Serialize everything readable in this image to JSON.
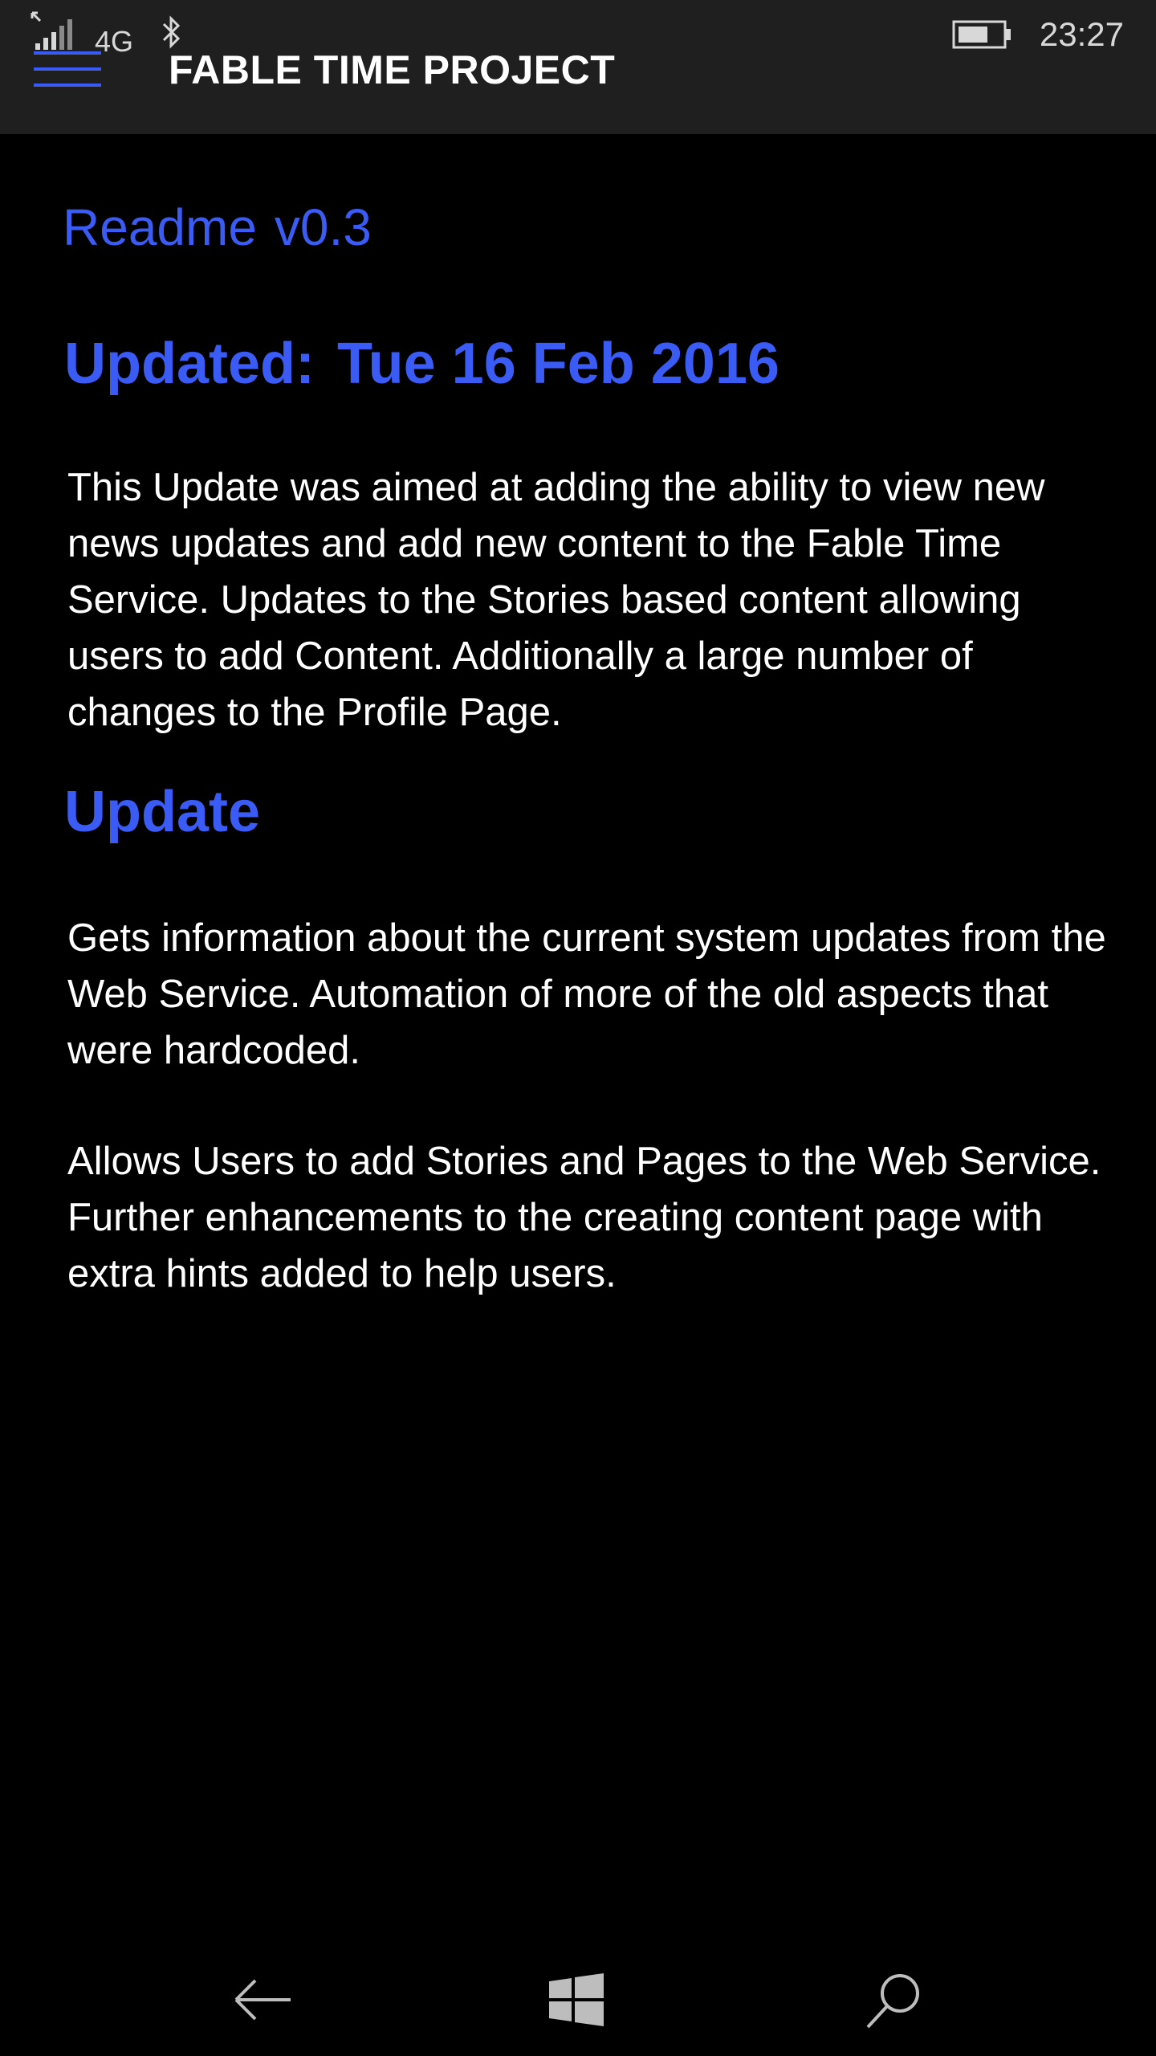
{
  "status_bar": {
    "network": "4G",
    "time": "23:27",
    "icons": [
      "signal-icon",
      "bluetooth-icon",
      "battery-icon"
    ]
  },
  "header": {
    "menu_icon": "hamburger-icon",
    "title": "FABLE TIME PROJECT"
  },
  "content": {
    "readme_label": "Readme",
    "version": "v0.3",
    "updated_label": "Updated:",
    "updated_date": "Tue 16 Feb 2016",
    "intro": "This Update was aimed at adding the ability to view new news updates and add new content to the Fable Time Service. Updates to the Stories based content allowing users to add Content. Additionally a large number of changes to the Profile Page.",
    "section_title": "Update",
    "paragraph_1": "Gets information about the current system updates from the Web Service. Automation of more of the old aspects that were hardcoded.",
    "paragraph_2": "Allows Users to add Stories and Pages to the Web Service. Further enhancements to the creating content page with extra hints added to help users."
  },
  "navbar": {
    "icons": [
      "back-arrow-icon",
      "windows-logo-icon",
      "search-icon"
    ]
  },
  "colors": {
    "accent": "#3a5cf5",
    "background": "#000000",
    "header_background": "#1f1f1f",
    "text": "#ffffff"
  }
}
